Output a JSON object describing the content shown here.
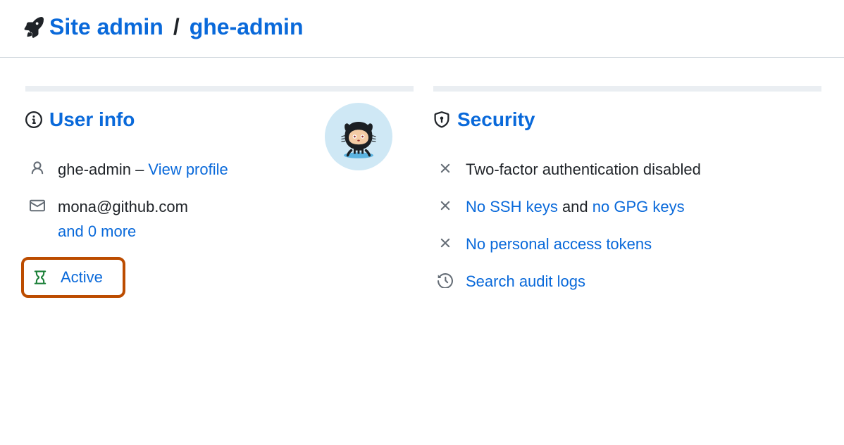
{
  "breadcrumb": {
    "root": "Site admin",
    "separator": "/",
    "current": "ghe-admin"
  },
  "user_info": {
    "title": "User info",
    "username": "ghe-admin",
    "dash": " – ",
    "view_profile": "View profile",
    "email": "mona@github.com",
    "more_emails": "and 0 more",
    "status": "Active"
  },
  "security": {
    "title": "Security",
    "two_factor": "Two-factor authentication disabled",
    "no_ssh": "No SSH keys",
    "and": " and ",
    "no_gpg": "no GPG keys",
    "no_tokens": "No personal access tokens",
    "audit_logs": "Search audit logs"
  }
}
